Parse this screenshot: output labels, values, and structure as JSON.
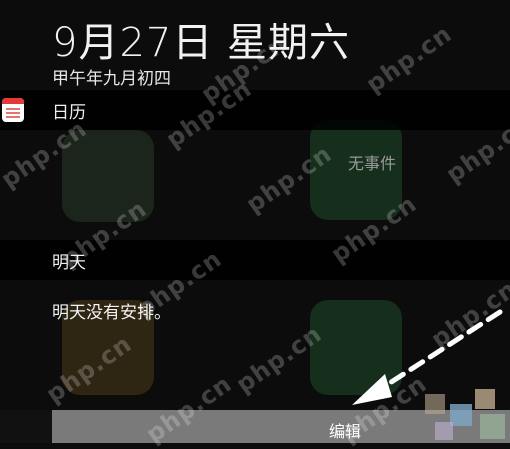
{
  "header": {
    "date": "9月27日 星期六",
    "lunar_date": "甲午年九月初四"
  },
  "calendar_section": {
    "label": "日历",
    "no_events_today": "无事件"
  },
  "tomorrow_section": {
    "label": "明天",
    "no_plans": "明天没有安排。"
  },
  "bottom_bar": {
    "edit_label": "编辑"
  },
  "watermark": {
    "text": "php.cn"
  },
  "colors": {
    "background": "#0c0c0c",
    "bar_gray": "#7a7a7a",
    "calendar_icon_red": "#e53935",
    "arrow_white": "#ffffff"
  }
}
